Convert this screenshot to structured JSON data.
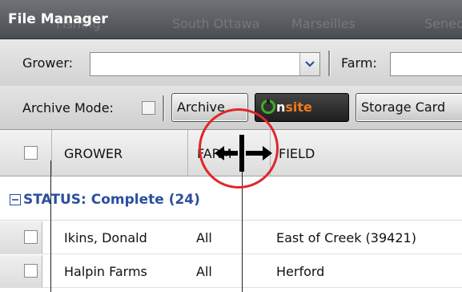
{
  "window": {
    "title": "File Manager",
    "background_names": [
      "Fishing",
      "South Ottawa",
      "Marseilles",
      "Seneca"
    ]
  },
  "filters": {
    "grower_label": "Grower:",
    "grower_value": "",
    "farm_label": "Farm:",
    "farm_value": ""
  },
  "toolbar": {
    "archive_mode_label": "Archive Mode:",
    "archive_mode_checked": false,
    "archive_button": "Archive",
    "onsite_button_prefix": "n",
    "onsite_button_suffix": "site",
    "storage_button": "Storage Card"
  },
  "table": {
    "columns": [
      "GROWER",
      "FARM",
      "FIELD"
    ],
    "groups": [
      {
        "label": "STATUS: Complete (24)",
        "rows": [
          {
            "grower": "Ikins, Donald",
            "farm": "All",
            "field": "East of Creek (39421)"
          },
          {
            "grower": "Halpin Farms",
            "farm": "All",
            "field": "Herford"
          }
        ]
      }
    ]
  },
  "colors": {
    "accent_blue": "#2b4f9e",
    "highlight_red": "#e0262b",
    "onsite_orange": "#f07a1c",
    "onsite_green": "#3fae2a"
  }
}
